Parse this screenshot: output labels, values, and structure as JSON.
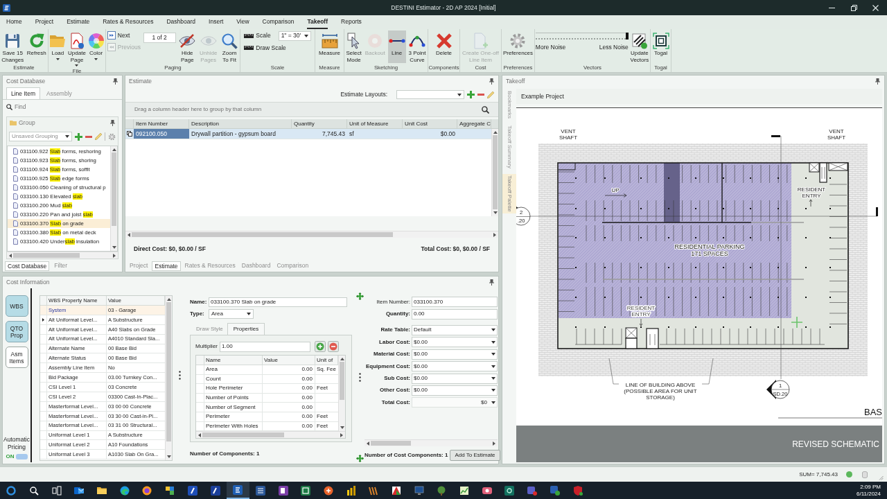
{
  "window": {
    "title": "DESTINI Estimator - 2D AP 2024 [Initial]"
  },
  "menu_tabs": [
    {
      "label": "Home",
      "selected": false
    },
    {
      "label": "Project",
      "selected": false
    },
    {
      "label": "Estimate",
      "selected": false
    },
    {
      "label": "Rates & Resources",
      "selected": false
    },
    {
      "label": "Dashboard",
      "selected": false
    },
    {
      "label": "Insert",
      "selected": false
    },
    {
      "label": "View",
      "selected": false
    },
    {
      "label": "Comparison",
      "selected": false
    },
    {
      "label": "Takeoff",
      "selected": true
    },
    {
      "label": "Reports",
      "selected": false
    }
  ],
  "ribbon": [
    {
      "label": "Estimate",
      "columns": [
        [
          {
            "kind": "large",
            "label": "Save 15\nChanges",
            "disabled": false,
            "dropdown": false
          }
        ],
        [
          {
            "kind": "large",
            "label": "Refresh",
            "disabled": false,
            "dropdown": false
          }
        ]
      ]
    },
    {
      "label": "File",
      "columns": [
        [
          {
            "kind": "large",
            "label": "Load",
            "disabled": false,
            "dropdown": true
          }
        ],
        [
          {
            "kind": "large",
            "label": "Update\nPage",
            "disabled": false,
            "dropdown": true
          }
        ],
        [
          {
            "kind": "large",
            "label": "Color",
            "disabled": false,
            "dropdown": true
          }
        ]
      ]
    },
    {
      "label": "Paging",
      "columns": [
        [
          {
            "kind": "small",
            "label": "Next",
            "disabled": false
          },
          {
            "kind": "small",
            "label": "Previous",
            "disabled": true
          }
        ],
        [
          {
            "kind": "field",
            "value": "1 of 2"
          }
        ],
        [
          {
            "kind": "large",
            "label": "Hide\nPage",
            "disabled": false,
            "dropdown": false
          }
        ],
        [
          {
            "kind": "large",
            "label": "Unhide\nPages",
            "disabled": true,
            "dropdown": false
          }
        ],
        [
          {
            "kind": "large",
            "label": "Zoom\nTo Fit",
            "disabled": false,
            "dropdown": false
          }
        ]
      ]
    },
    {
      "label": "Scale",
      "columns": [
        [
          {
            "kind": "combo",
            "label": "Scale",
            "value": "1\" = 30'"
          },
          {
            "kind": "small",
            "label": "Draw Scale",
            "disabled": false
          }
        ]
      ]
    },
    {
      "label": "Measure",
      "columns": [
        [
          {
            "kind": "large",
            "label": "Measure",
            "disabled": false,
            "dropdown": false
          }
        ]
      ]
    },
    {
      "label": "Sketching",
      "columns": [
        [
          {
            "kind": "large",
            "label": "Select\nMode",
            "disabled": false,
            "dropdown": false,
            "selected": false
          }
        ],
        [
          {
            "kind": "large",
            "label": "Backout",
            "disabled": true,
            "dropdown": false,
            "selected": false
          }
        ],
        [
          {
            "kind": "large",
            "label": "Line",
            "disabled": false,
            "dropdown": false,
            "selected": true
          }
        ],
        [
          {
            "kind": "large",
            "label": "3 Point\nCurve",
            "disabled": false,
            "dropdown": false,
            "selected": false
          }
        ]
      ]
    },
    {
      "label": "Components",
      "columns": [
        [
          {
            "kind": "large",
            "label": "Delete",
            "disabled": false,
            "dropdown": false
          }
        ]
      ]
    },
    {
      "label": "Cost",
      "columns": [
        [
          {
            "kind": "large",
            "label": "Create One-off\nLine Item",
            "disabled": true,
            "dropdown": false
          }
        ]
      ]
    },
    {
      "label": "Preferences",
      "columns": [
        [
          {
            "kind": "large",
            "label": "Preferences",
            "disabled": false,
            "dropdown": false
          }
        ]
      ]
    },
    {
      "label": "Vectors",
      "columns": [
        [
          {
            "kind": "slider",
            "min_label": "More Noise",
            "max_label": "Less Noise",
            "level": 1
          }
        ],
        [
          {
            "kind": "large",
            "label": "Update\nVectors",
            "disabled": false,
            "dropdown": false
          }
        ]
      ]
    },
    {
      "label": "Togal",
      "columns": [
        [
          {
            "kind": "large",
            "label": "Togal",
            "disabled": false,
            "dropdown": false
          }
        ]
      ]
    }
  ],
  "cost_database": {
    "title": "Cost Database",
    "tabs": [
      {
        "label": "Line Item",
        "selected": true
      },
      {
        "label": "Assembly",
        "selected": false
      }
    ],
    "find_placeholder": "Find",
    "group_title": "Group",
    "grouping": "Unsaved Grouping",
    "items": [
      {
        "before": "031100.922 ",
        "match": "Slab",
        "after": " forms, reshoring",
        "selected": false
      },
      {
        "before": "031100.923 ",
        "match": "Slab",
        "after": " forms, shoring",
        "selected": false
      },
      {
        "before": "031100.924 ",
        "match": "Slab",
        "after": " forms, soffit",
        "selected": false
      },
      {
        "before": "031100.925 ",
        "match": "Slab",
        "after": " edge forms",
        "selected": false
      },
      {
        "before": "033100.050 Cleaning of structural p",
        "selected": false
      },
      {
        "before": "033100.130 Elevated ",
        "match": "slab",
        "selected": false
      },
      {
        "before": "033100.200 Mud ",
        "match": "slab",
        "selected": false
      },
      {
        "before": "033100.220 Pan and joist ",
        "match": "slab",
        "selected": false
      },
      {
        "before": "033100.370 ",
        "match": "Slab",
        "after": " on grade",
        "selected": true
      },
      {
        "before": "033100.380 ",
        "match": "Slab",
        "after": " on metal deck",
        "selected": false
      },
      {
        "before": "033100.420 Under",
        "match": "slab",
        "after": " insulation",
        "selected": false
      }
    ],
    "bottom_tabs": [
      {
        "label": "Cost Database",
        "selected": true
      },
      {
        "label": "Filter",
        "selected": false
      }
    ]
  },
  "estimate": {
    "title": "Estimate",
    "layouts_label": "Estimate Layouts:",
    "group_hint": "Drag a column header here to group by that column",
    "columns": [
      "Item Number",
      "Description",
      "Quantity",
      "Unit of Measure",
      "Unit Cost",
      "Aggregate C"
    ],
    "rows": [
      {
        "cells": [
          "092100.050",
          "Drywall partition - gypsum board",
          "7,745.43",
          "sf",
          "$0.00"
        ],
        "selected": true
      }
    ],
    "direct_cost": "Direct Cost: $0, $0.00 / SF",
    "total_cost": "Total Cost: $0, $0.00 / SF",
    "tabs": [
      {
        "label": "Project",
        "selected": false
      },
      {
        "label": "Estimate",
        "selected": true
      },
      {
        "label": "Rates & Resources",
        "selected": false
      },
      {
        "label": "Dashboard",
        "selected": false
      },
      {
        "label": "Comparison",
        "selected": false
      }
    ]
  },
  "cost_information": {
    "title": "Cost Information",
    "side_buttons": [
      {
        "label": "WBS",
        "on": true
      },
      {
        "label": "QTO\nProp",
        "on": true
      },
      {
        "label": "Asm\nItems",
        "on": false
      }
    ],
    "auto_pricing": {
      "label": "Automatic\nPricing",
      "state": "ON",
      "on": true
    },
    "wbs": {
      "columns": [
        "WBS Property Name",
        "Value"
      ],
      "rows": [
        {
          "name": "System",
          "value": "03 - Garage",
          "selected": true,
          "current": false
        },
        {
          "name": "Alt Uniformat Level...",
          "value": "A Substructure",
          "selected": false,
          "current": true
        },
        {
          "name": "Alt Uniformat Level...",
          "value": "A40 Slabs on Grade",
          "selected": false,
          "current": false
        },
        {
          "name": "Alt Uniformat Level...",
          "value": "A4010 Standard Sla...",
          "selected": false,
          "current": false
        },
        {
          "name": "Alternate Name",
          "value": "00 Base Bid",
          "selected": false,
          "current": false
        },
        {
          "name": "Alternate Status",
          "value": "00 Base Bid",
          "selected": false,
          "current": false
        },
        {
          "name": "Assembly Line Item",
          "value": "No",
          "selected": false,
          "current": false
        },
        {
          "name": "Bid Package",
          "value": "03.00 Turnkey Con...",
          "selected": false,
          "current": false
        },
        {
          "name": "CSI Level 1",
          "value": "03 Concrete",
          "selected": false,
          "current": false
        },
        {
          "name": "CSI Level 2",
          "value": "03300 Cast-In-Plac...",
          "selected": false,
          "current": false
        },
        {
          "name": "Masterformat Level...",
          "value": "03 00 00 Concrete",
          "selected": false,
          "current": false
        },
        {
          "name": "Masterformat Level...",
          "value": "03 30 00 Cast-in-Pl...",
          "selected": false,
          "current": false
        },
        {
          "name": "Masterformat Level...",
          "value": "03 31 00 Structural...",
          "selected": false,
          "current": false
        },
        {
          "name": "Uniformat Level 1",
          "value": "A Substructure",
          "selected": false,
          "current": false
        },
        {
          "name": "Uniformat Level 2",
          "value": "A10 Foundations",
          "selected": false,
          "current": false
        },
        {
          "name": "Uniformat Level 3",
          "value": "A1030 Slab On Gra...",
          "selected": false,
          "current": false
        }
      ]
    },
    "component": {
      "name_label": "Name:",
      "name": "033100.370 Slab on grade",
      "type_label": "Type:",
      "type": "Area",
      "tabs": [
        {
          "label": "Draw Style",
          "selected": false
        },
        {
          "label": "Properties",
          "selected": true
        }
      ],
      "multiplier_label": "Multiplier",
      "multiplier": "1.00",
      "columns": [
        "Name",
        "Value",
        "Unit of"
      ],
      "rows": [
        {
          "name": "Area",
          "value": "0.00",
          "unit": "Sq. Fee"
        },
        {
          "name": "Count",
          "value": "0.00"
        },
        {
          "name": "Hole Perimeter",
          "value": "0.00",
          "unit": "Feet"
        },
        {
          "name": "Number of Points",
          "value": "0.00"
        },
        {
          "name": "Number of Segment",
          "value": "0.00"
        },
        {
          "name": "Perimeter",
          "value": "0.00",
          "unit": "Feet"
        },
        {
          "name": "Perimeter With Holes",
          "value": "0.00",
          "unit": "Feet"
        }
      ],
      "count": "Number of Components: 1"
    },
    "pricing": {
      "fields": [
        {
          "label": "Item Number:",
          "value": "033100.370",
          "kind": "text",
          "bold": false
        },
        {
          "label": "Quantity:",
          "value": "0.00",
          "kind": "text",
          "bold": true
        },
        {
          "label": "Rate Table:",
          "value": "Default",
          "kind": "dropdown",
          "bold": true
        },
        {
          "label": "Labor Cost:",
          "value": "$0.00",
          "kind": "dropdown",
          "bold": true
        },
        {
          "label": "Material Cost:",
          "value": "$0.00",
          "kind": "dropdown",
          "bold": true
        },
        {
          "label": "Equipment Cost:",
          "value": "$0.00",
          "kind": "dropdown",
          "bold": true
        },
        {
          "label": "Sub Cost:",
          "value": "$0.00",
          "kind": "dropdown",
          "bold": true
        },
        {
          "label": "Other Cost:",
          "value": "$0.00",
          "kind": "dropdown",
          "bold": true
        },
        {
          "label": "Total Cost:",
          "value": "$0",
          "kind": "total",
          "bold": true
        }
      ],
      "count": "Number of Cost Components: 1",
      "button": "Add To Estimate"
    }
  },
  "takeoff": {
    "title": "Takeoff",
    "side_tabs": [
      {
        "label": "Bookmarks",
        "selected": false
      },
      {
        "label": "Takeoff Summary",
        "selected": false
      },
      {
        "label": "Takeoff Palette",
        "selected": true
      }
    ],
    "document_tab": "Example Project",
    "plan_labels": [
      {
        "lines": [
          "VENT",
          "SHAFT"
        ]
      },
      {
        "lines": [
          "VENT",
          "SHAFT"
        ]
      },
      {
        "lines": [
          "UP"
        ]
      },
      {
        "lines": [
          "RESIDENT",
          "ENTRY"
        ]
      },
      {
        "lines": [
          "RESIDENTIAL PARKING",
          "171 SPACES"
        ]
      },
      {
        "lines": [
          "RESIDENT",
          "ENTRY"
        ]
      },
      {
        "lines": [
          "LINE OF BUILDING ABOVE",
          "(POSSIBLE AREA FOR UNIT",
          "STORAGE)"
        ]
      }
    ],
    "section_markers": [
      {
        "number": "1",
        "sheet": "SD.20"
      },
      {
        "number": "2",
        "sheet": ".20"
      }
    ],
    "sheet_title": "BAS",
    "title_block": "REVISED SCHEMATIC"
  },
  "status_bar": {
    "sum": "SUM= 7,745.43"
  },
  "taskbar": {
    "apps": [
      {
        "selected": false
      },
      {
        "selected": false
      },
      {
        "selected": false
      },
      {
        "selected": false
      },
      {
        "selected": false
      },
      {
        "selected": false
      },
      {
        "selected": false
      },
      {
        "selected": false
      },
      {
        "selected": false
      },
      {
        "selected": false
      },
      {
        "selected": true
      },
      {
        "selected": false
      },
      {
        "selected": false
      },
      {
        "selected": false
      },
      {
        "selected": false
      },
      {
        "selected": false
      },
      {
        "selected": false
      },
      {
        "selected": false
      },
      {
        "selected": false
      },
      {
        "selected": false
      },
      {
        "selected": false
      },
      {
        "selected": false
      },
      {
        "selected": false
      },
      {
        "selected": false
      },
      {
        "selected": false
      },
      {
        "selected": false
      }
    ],
    "time": "2:09 PM",
    "date": "6/11/2024"
  }
}
